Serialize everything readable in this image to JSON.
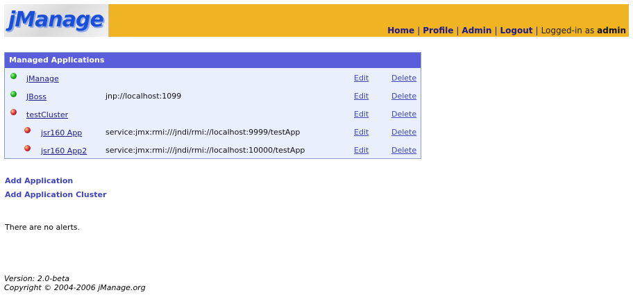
{
  "header": {
    "logo": "jManage",
    "nav": {
      "home": "Home",
      "profile": "Profile",
      "admin": "Admin",
      "logout": "Logout",
      "separator": "|",
      "logged_in_label": "Logged-in as",
      "user": "admin"
    },
    "colors": {
      "bar": "#f0b321",
      "logo_text": "#1a4fd8"
    }
  },
  "apps_panel": {
    "title": "Managed Applications",
    "rows": [
      {
        "name": "jManage",
        "url": "",
        "status": "green",
        "edit": "Edit",
        "delete": "Delete"
      },
      {
        "name": "JBoss",
        "url": "jnp://localhost:1099",
        "status": "green",
        "edit": "Edit",
        "delete": "Delete"
      },
      {
        "name": "testCluster",
        "url": "",
        "status": "red",
        "edit": "Edit",
        "delete": "Delete"
      },
      {
        "name": "jsr160 App",
        "url": "service:jmx:rmi:///jndi/rmi://localhost:9999/testApp",
        "status": "red",
        "edit": "Edit",
        "delete": "Delete"
      },
      {
        "name": "jsr160 App2",
        "url": "service:jmx:rmi:///jndi/rmi://localhost:10000/testApp",
        "status": "red",
        "edit": "Edit",
        "delete": "Delete"
      }
    ]
  },
  "actions": {
    "add_application": "Add Application",
    "add_cluster": "Add Application Cluster"
  },
  "alerts": {
    "text": "There are no alerts."
  },
  "footer": {
    "version": "Version: 2.0-beta",
    "copyright": "Copyright © 2004-2006 jManage.org"
  }
}
